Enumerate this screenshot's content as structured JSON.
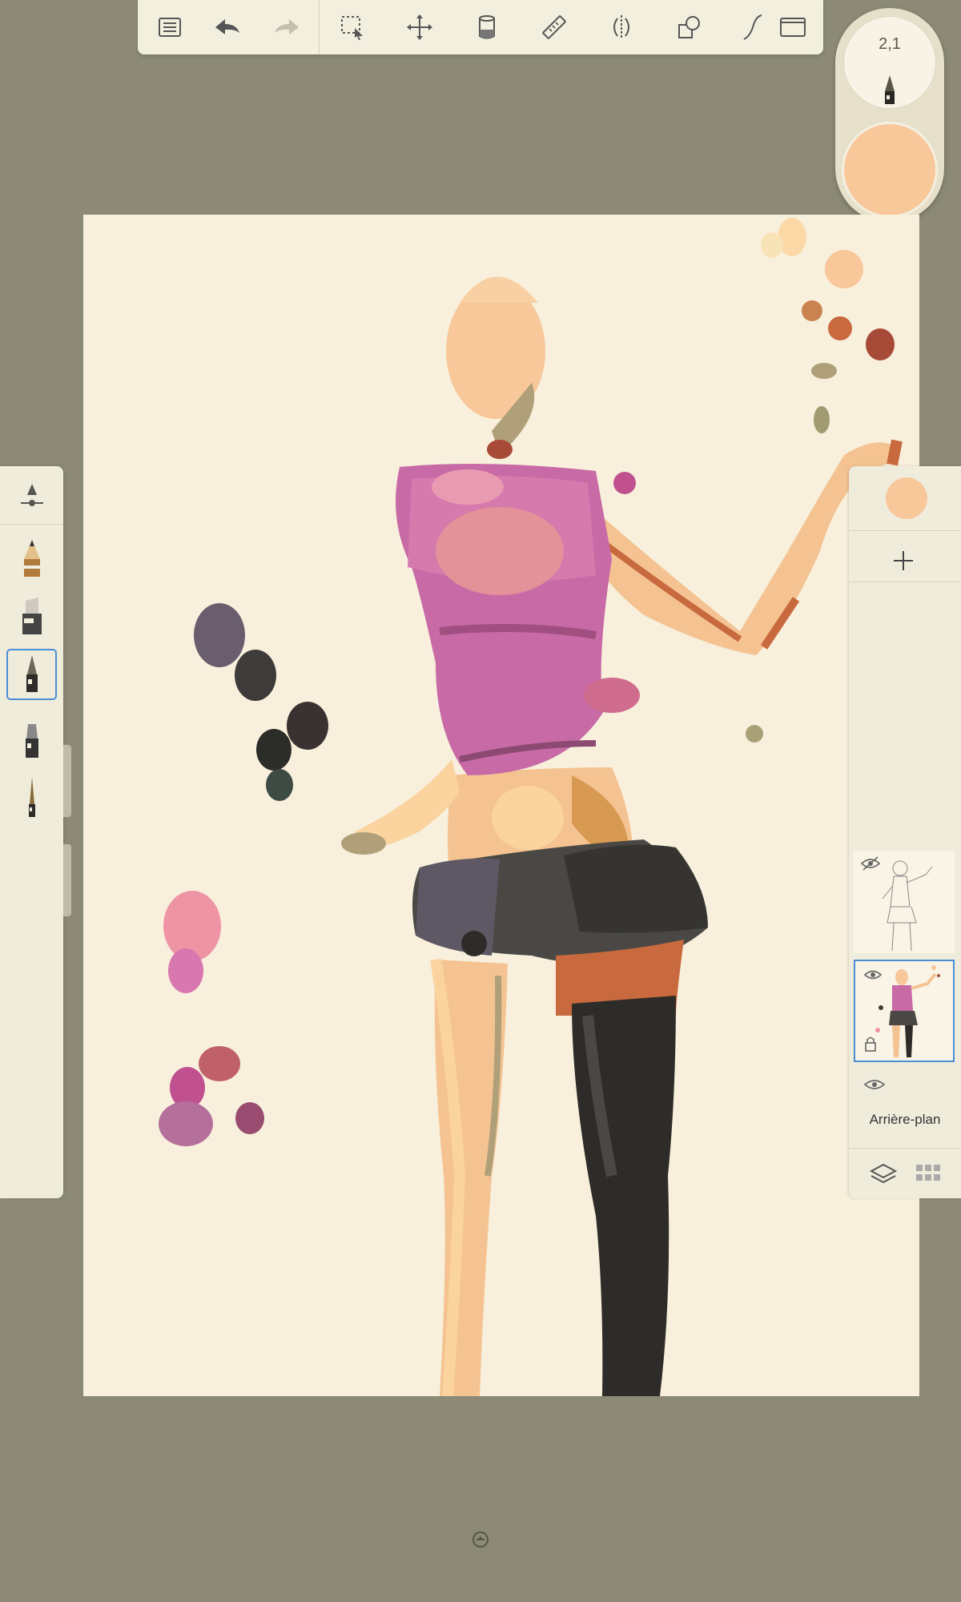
{
  "toolbar": {
    "buttons": [
      {
        "name": "list-icon"
      },
      {
        "name": "undo-icon"
      },
      {
        "name": "redo-icon"
      },
      {
        "name": "selection-icon"
      },
      {
        "name": "transform-icon"
      },
      {
        "name": "fill-bucket-icon"
      },
      {
        "name": "ruler-icon"
      },
      {
        "name": "symmetry-icon"
      },
      {
        "name": "shapes-icon"
      },
      {
        "name": "stroke-icon"
      },
      {
        "name": "fullscreen-icon"
      }
    ]
  },
  "puck": {
    "brush_size": "2,1",
    "current_color": "#f8c79a"
  },
  "brushes": [
    {
      "name": "brush-settings-icon"
    },
    {
      "name": "pencil-icon"
    },
    {
      "name": "marker-icon"
    },
    {
      "name": "paint-brush-icon",
      "selected": true
    },
    {
      "name": "airbrush-icon"
    },
    {
      "name": "fine-brush-icon"
    }
  ],
  "layers": {
    "current_color": "#f8c79a",
    "items": [
      {
        "name": "sketch-layer",
        "visible": false
      },
      {
        "name": "paint-layer",
        "visible": true,
        "selected": true,
        "locked": true
      },
      {
        "name": "background-layer",
        "visible": true,
        "label": "Arrière-plan"
      }
    ]
  },
  "colors": {
    "background": "#8c8a76",
    "canvas": "#f8f0dc",
    "accent": "#4a8ed6",
    "skin": "#f8c79a",
    "top": "#c86aa6",
    "skirt": "#4a4844",
    "boot": "#2e2c28"
  }
}
